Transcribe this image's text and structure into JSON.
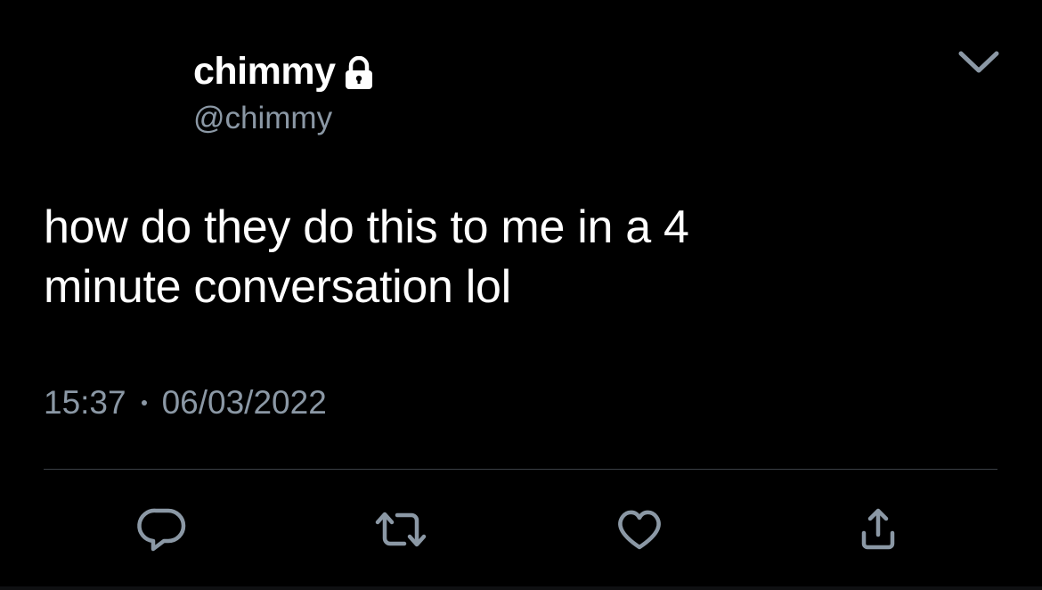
{
  "tweet": {
    "display_name": "chimmy",
    "handle": "@chimmy",
    "text_line1": "how do they do this to me in a 4",
    "text_line2": "minute conversation lol",
    "time": "15:37",
    "date": "06/03/2022"
  },
  "icons": {
    "lock": "lock-icon",
    "more": "chevron-down-icon",
    "reply": "reply-icon",
    "retweet": "retweet-icon",
    "like": "heart-icon",
    "share": "share-icon"
  },
  "colors": {
    "background": "#000000",
    "text": "#ffffff",
    "secondary": "#8b98a5",
    "divider": "#3a3f45"
  }
}
